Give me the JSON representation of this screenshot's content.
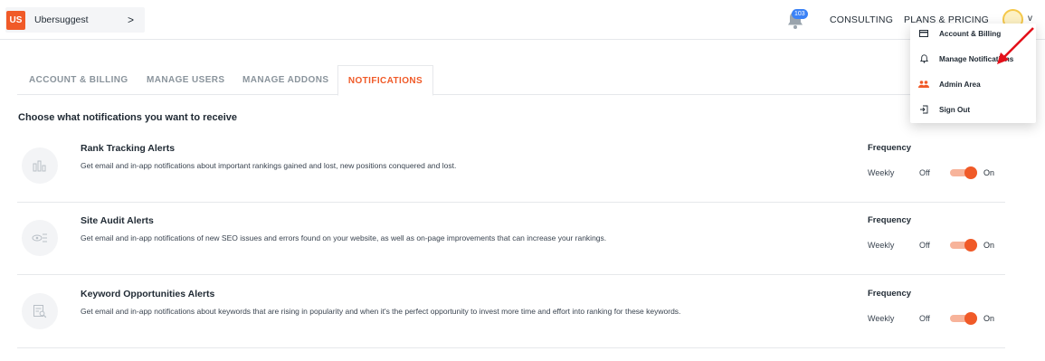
{
  "header": {
    "project_badge": "US",
    "project_name": "Ubersuggest",
    "project_chevron": ">",
    "bell_count": "103",
    "nav": {
      "consulting": "CONSULTING",
      "plans": "PLANS & PRICING"
    },
    "avatar_chevron": "v"
  },
  "dropdown": {
    "items": [
      {
        "label": "Account & Billing",
        "icon": "credit-card-icon"
      },
      {
        "label": "Manage Notifications",
        "icon": "bell-icon"
      },
      {
        "label": "Admin Area",
        "icon": "users-icon"
      },
      {
        "label": "Sign Out",
        "icon": "sign-out-icon"
      }
    ]
  },
  "tabs": [
    {
      "label": "ACCOUNT & BILLING",
      "active": false
    },
    {
      "label": "MANAGE USERS",
      "active": false
    },
    {
      "label": "MANAGE ADDONS",
      "active": false
    },
    {
      "label": "NOTIFICATIONS",
      "active": true
    }
  ],
  "section_heading": "Choose what notifications you want to receive",
  "alerts": [
    {
      "title": "Rank Tracking Alerts",
      "description": "Get email and in-app notifications about important rankings gained and lost, new positions conquered and lost.",
      "frequency_label": "Frequency",
      "frequency": "Weekly",
      "off_label": "Off",
      "on_label": "On",
      "enabled": true,
      "icon": "bar-chart-icon"
    },
    {
      "title": "Site Audit Alerts",
      "description": "Get email and in-app notifications of new SEO issues and errors found on your website, as well as on-page improvements that can increase your rankings.",
      "frequency_label": "Frequency",
      "frequency": "Weekly",
      "off_label": "Off",
      "on_label": "On",
      "enabled": true,
      "icon": "eye-list-icon"
    },
    {
      "title": "Keyword Opportunities Alerts",
      "description": "Get email and in-app notifications about keywords that are rising in popularity and when it's the perfect opportunity to invest more time and effort into ranking for these keywords.",
      "frequency_label": "Frequency",
      "frequency": "Weekly",
      "off_label": "Off",
      "on_label": "On",
      "enabled": true,
      "icon": "search-document-icon"
    }
  ],
  "colors": {
    "accent": "#f05a28",
    "toggle_track": "#f7b39a",
    "badge_blue": "#3b82f6",
    "arrow_red": "#e3101a"
  }
}
